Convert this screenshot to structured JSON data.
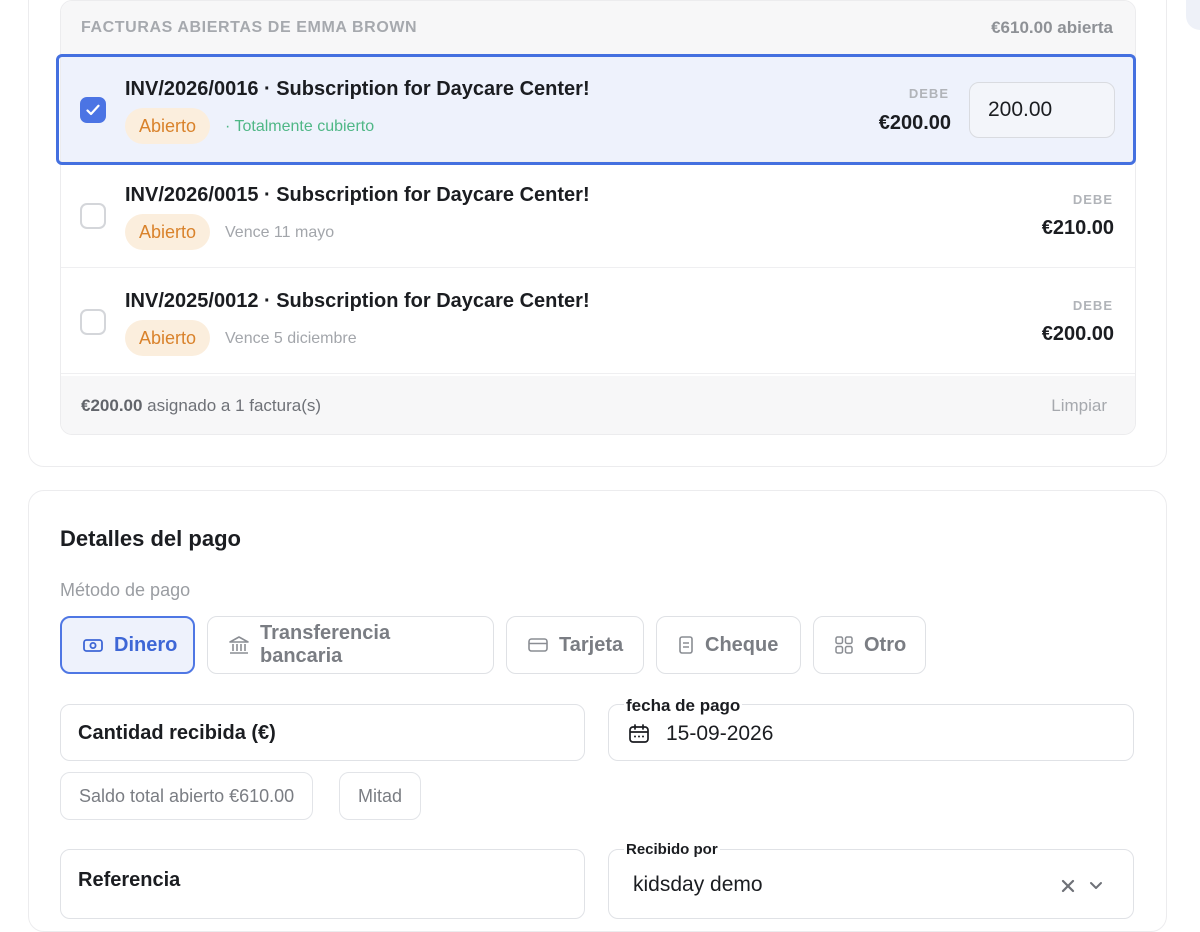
{
  "open_invoices": {
    "header_title": "FACTURAS ABIERTAS DE EMMA BROWN",
    "header_total": "€610.00 abierta",
    "items": [
      {
        "title": "INV/2026/0016 · Subscription for Daycare Center!",
        "status": "Abierto",
        "note": "· Totalmente cubierto",
        "due_label": "DEBE",
        "due_amount": "€200.00",
        "allocated": "200.00",
        "checked": true
      },
      {
        "title": "INV/2026/0015 · Subscription for Daycare Center!",
        "status": "Abierto",
        "note": "Vence 11 mayo",
        "due_label": "DEBE",
        "due_amount": "€210.00",
        "checked": false
      },
      {
        "title": "INV/2025/0012 · Subscription for Daycare Center!",
        "status": "Abierto",
        "note": "Vence 5 diciembre",
        "due_label": "DEBE",
        "due_amount": "€200.00",
        "checked": false
      }
    ],
    "footer": {
      "assigned_amount": "€200.00",
      "assigned_text": " asignado a 1 factura(s)",
      "clear_label": "Limpiar"
    }
  },
  "payment_details": {
    "title": "Detalles del pago",
    "method_label": "Método de pago",
    "methods": [
      {
        "label": "Dinero",
        "icon": "cash-icon",
        "active": true
      },
      {
        "label": "Transferencia bancaria",
        "icon": "bank-icon",
        "active": false
      },
      {
        "label": "Tarjeta",
        "icon": "card-icon",
        "active": false
      },
      {
        "label": "Cheque",
        "icon": "cheque-icon",
        "active": false
      },
      {
        "label": "Otro",
        "icon": "grid-icon",
        "active": false
      }
    ],
    "amount_received_label": "Cantidad recibida (€)",
    "payment_date_label": "fecha de pago",
    "payment_date_value": "15-09-2026",
    "quick_fill": {
      "full_balance": "Saldo total abierto €610.00",
      "half": "Mitad"
    },
    "reference_label": "Referencia",
    "received_by_label": "Recibido por",
    "received_by_value": "kidsday demo"
  },
  "colors": {
    "accent": "#4470e0",
    "badge_bg": "#fbeedd",
    "badge_text": "#d9822b",
    "success_text": "#4fb786"
  }
}
